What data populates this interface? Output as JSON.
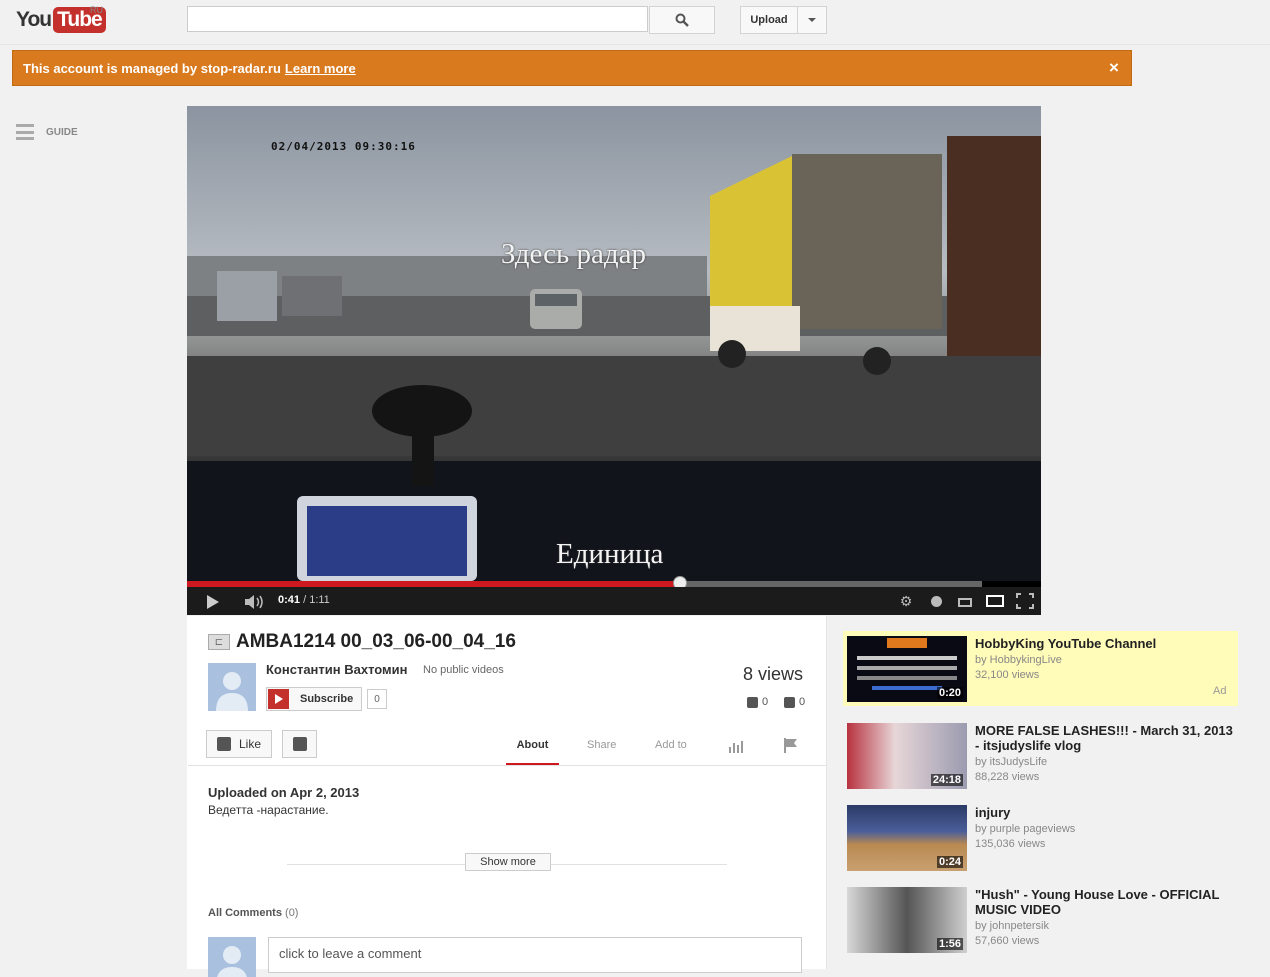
{
  "header": {
    "logo_you": "You",
    "logo_tube": "Tube",
    "logo_country": "RU",
    "search_placeholder": "",
    "upload_label": "Upload"
  },
  "alert": {
    "message": "This account is managed by stop-radar.ru",
    "link": "Learn more",
    "close": "×"
  },
  "guide": {
    "label": "GUIDE"
  },
  "player": {
    "timestamp": "02/04/2013 09:30:16",
    "caption_top": "Здесь радар",
    "caption_bottom": "Единица",
    "current_time": "0:41",
    "total_time": "1:11",
    "progress_fraction": 0.577,
    "buffered_fraction": 0.931
  },
  "video": {
    "title": "AMBA1214 00_03_06-00_04_16",
    "owner": "Константин Вахтомин",
    "owner_videos": "No public videos",
    "subscribe": "Subscribe",
    "subscriber_count": "0",
    "views": "8 views",
    "likes": "0",
    "dislikes": "0",
    "like_label": "Like"
  },
  "tabs": {
    "about": "About",
    "share": "Share",
    "add_to": "Add to"
  },
  "details": {
    "uploaded": "Uploaded on Apr 2, 2013",
    "description": "Ведетта -нарастание.",
    "show_more": "Show more"
  },
  "comments": {
    "label": "All Comments",
    "count": "(0)",
    "placeholder": "click to leave a comment"
  },
  "sidebar": {
    "items": [
      {
        "title": "HobbyKing YouTube Channel",
        "title2": "",
        "by": "by HobbykingLive",
        "views": "32,100 views",
        "duration": "0:20",
        "ad": "Ad"
      },
      {
        "title": "MORE FALSE LASHES!!! - March 31, 2013",
        "title2": "- itsjudyslife vlog",
        "by": "by itsJudysLife",
        "views": "88,228 views",
        "duration": "24:18"
      },
      {
        "title": "injury",
        "title2": "",
        "by": "by purple pageviews",
        "views": "135,036 views",
        "duration": "0:24"
      },
      {
        "title": "\"Hush\" - Young House Love - OFFICIAL",
        "title2": "MUSIC VIDEO",
        "by": "by johnpetersik",
        "views": "57,660 views",
        "duration": "1:56"
      }
    ]
  },
  "colors": {
    "brand_red": "#c4302b",
    "alert_orange": "#d97a1e",
    "progress_red": "#cc181e",
    "ad_yellow": "#fffbb8"
  }
}
